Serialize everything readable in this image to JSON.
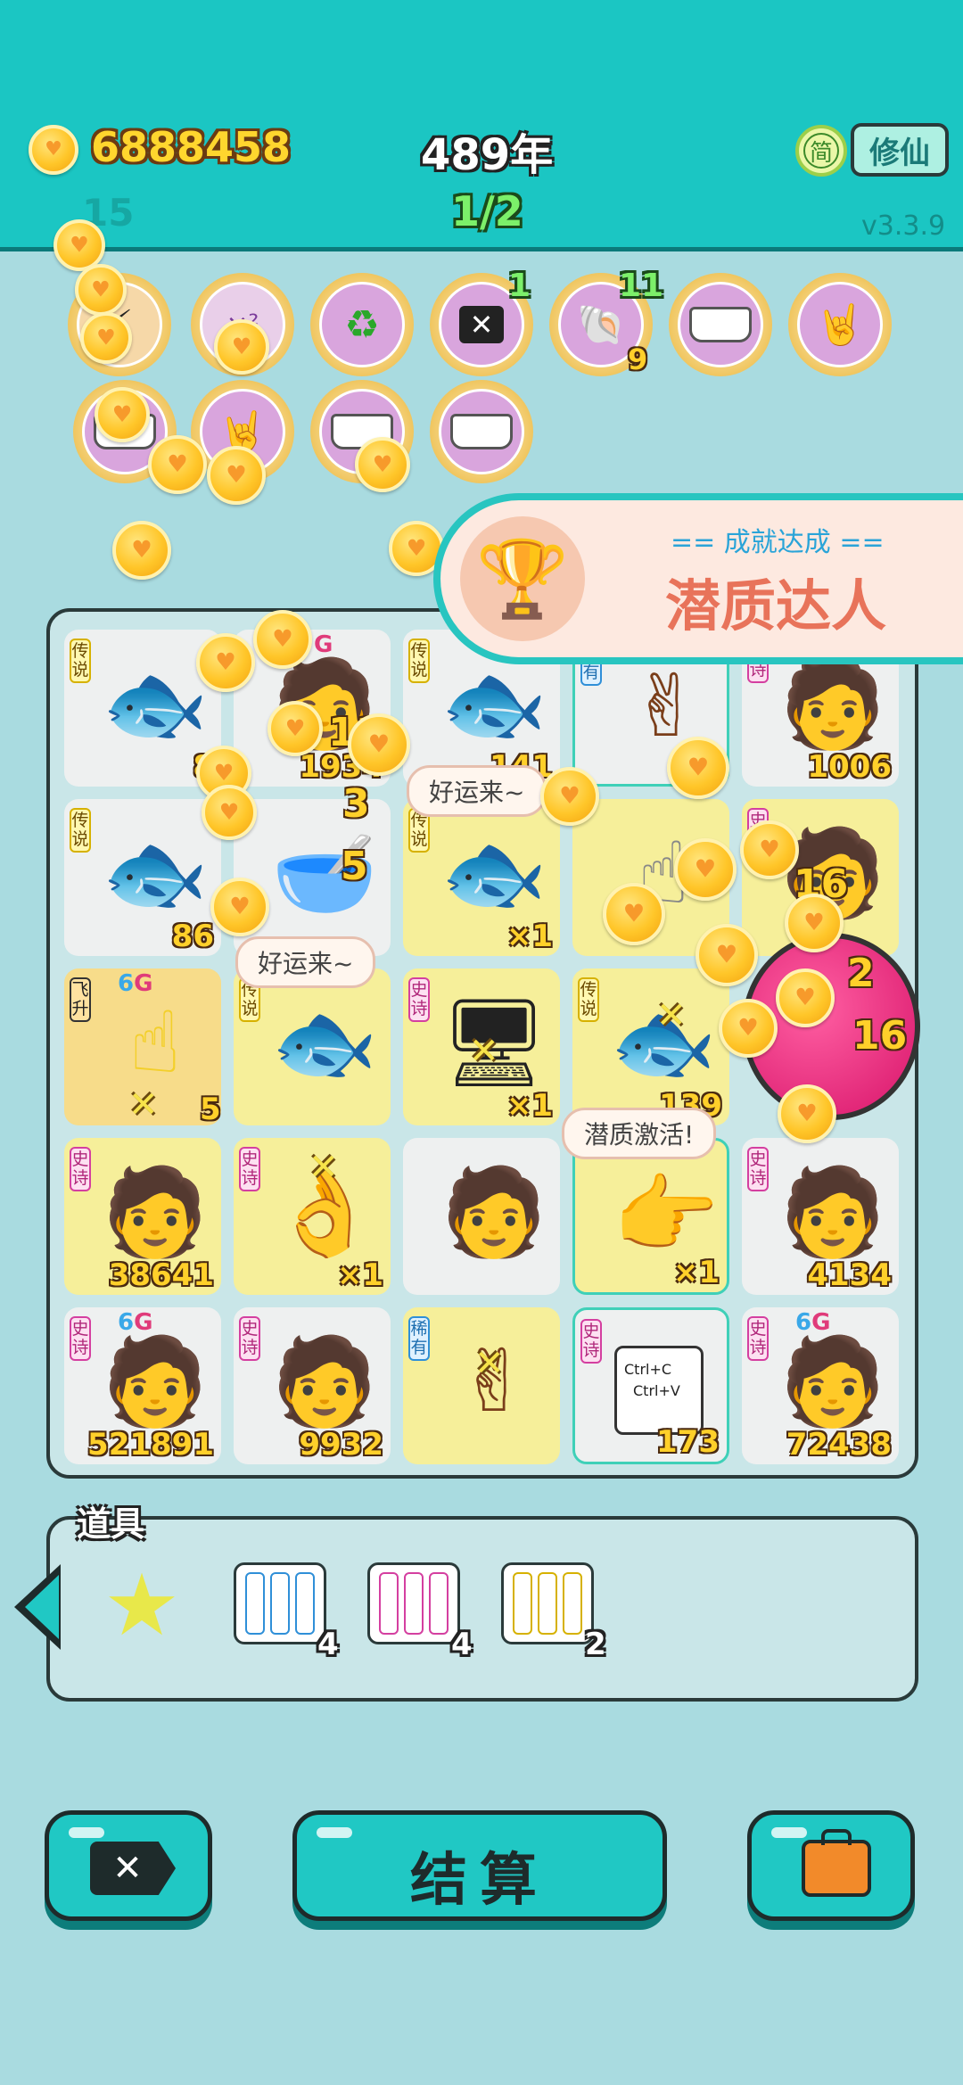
{
  "header": {
    "coins": "6888458",
    "year": "489年",
    "secondary_count": "15",
    "progress": "1/2",
    "lang_label": "简",
    "mode_label": "修仙",
    "version": "v3.3.9"
  },
  "skills": {
    "s4_badge": "1",
    "s5_badge": "11",
    "s5_sub": "9"
  },
  "achievement": {
    "heading": "== 成就达成 ==",
    "title": "潜质达人"
  },
  "board": {
    "tiles": [
      {
        "tag": "传说",
        "num": "8"
      },
      {
        "tag": "",
        "num": "1934",
        "g": "G"
      },
      {
        "tag": "传说",
        "num": "141"
      },
      {
        "tag": "稀有",
        "num": ""
      },
      {
        "tag": "史诗",
        "num": "1006"
      },
      {
        "tag": "传说",
        "num": "86"
      },
      {
        "tag": "",
        "num": ""
      },
      {
        "tag": "传说",
        "num": "×1"
      },
      {
        "tag": "",
        "num": ""
      },
      {
        "tag": "史诗",
        "num": ""
      },
      {
        "tag": "飞升",
        "num": "5",
        "g": "6",
        "g2": "G"
      },
      {
        "tag": "传说",
        "num": ""
      },
      {
        "tag": "史诗",
        "num": "×1"
      },
      {
        "tag": "传说",
        "num": "139"
      },
      {
        "tag": "",
        "num": ""
      },
      {
        "tag": "史诗",
        "num": "38641"
      },
      {
        "tag": "史诗",
        "num": "×1"
      },
      {
        "tag": "",
        "num": ""
      },
      {
        "tag": "",
        "num": "×1"
      },
      {
        "tag": "史诗",
        "num": "4134"
      },
      {
        "tag": "史诗",
        "num": "521891",
        "g": "6",
        "g2": "G"
      },
      {
        "tag": "史诗",
        "num": "9932"
      },
      {
        "tag": "稀有",
        "num": ""
      },
      {
        "tag": "史诗",
        "num": "173",
        "ctrl1": "Ctrl+C",
        "ctrl2": "Ctrl+V"
      },
      {
        "tag": "史诗",
        "num": "72438",
        "g": "6",
        "g2": "G"
      }
    ],
    "bubbles": [
      "好运来~",
      "好运来~",
      "潜质激活!"
    ],
    "floating_numbers": [
      "11",
      "3",
      "5",
      "16",
      "2",
      "16"
    ]
  },
  "props": {
    "title": "道具",
    "items": [
      {
        "name": "star",
        "count": ""
      },
      {
        "name": "稀有",
        "count": "4"
      },
      {
        "name": "史诗",
        "count": "4"
      },
      {
        "name": "传说",
        "count": "2"
      }
    ]
  },
  "actions": {
    "settle_label": "结算"
  },
  "colors": {
    "teal": "#1bc6c3",
    "board_bg": "#c9e6e8",
    "gold": "#ffd02a",
    "popup_text": "#e8735a"
  }
}
